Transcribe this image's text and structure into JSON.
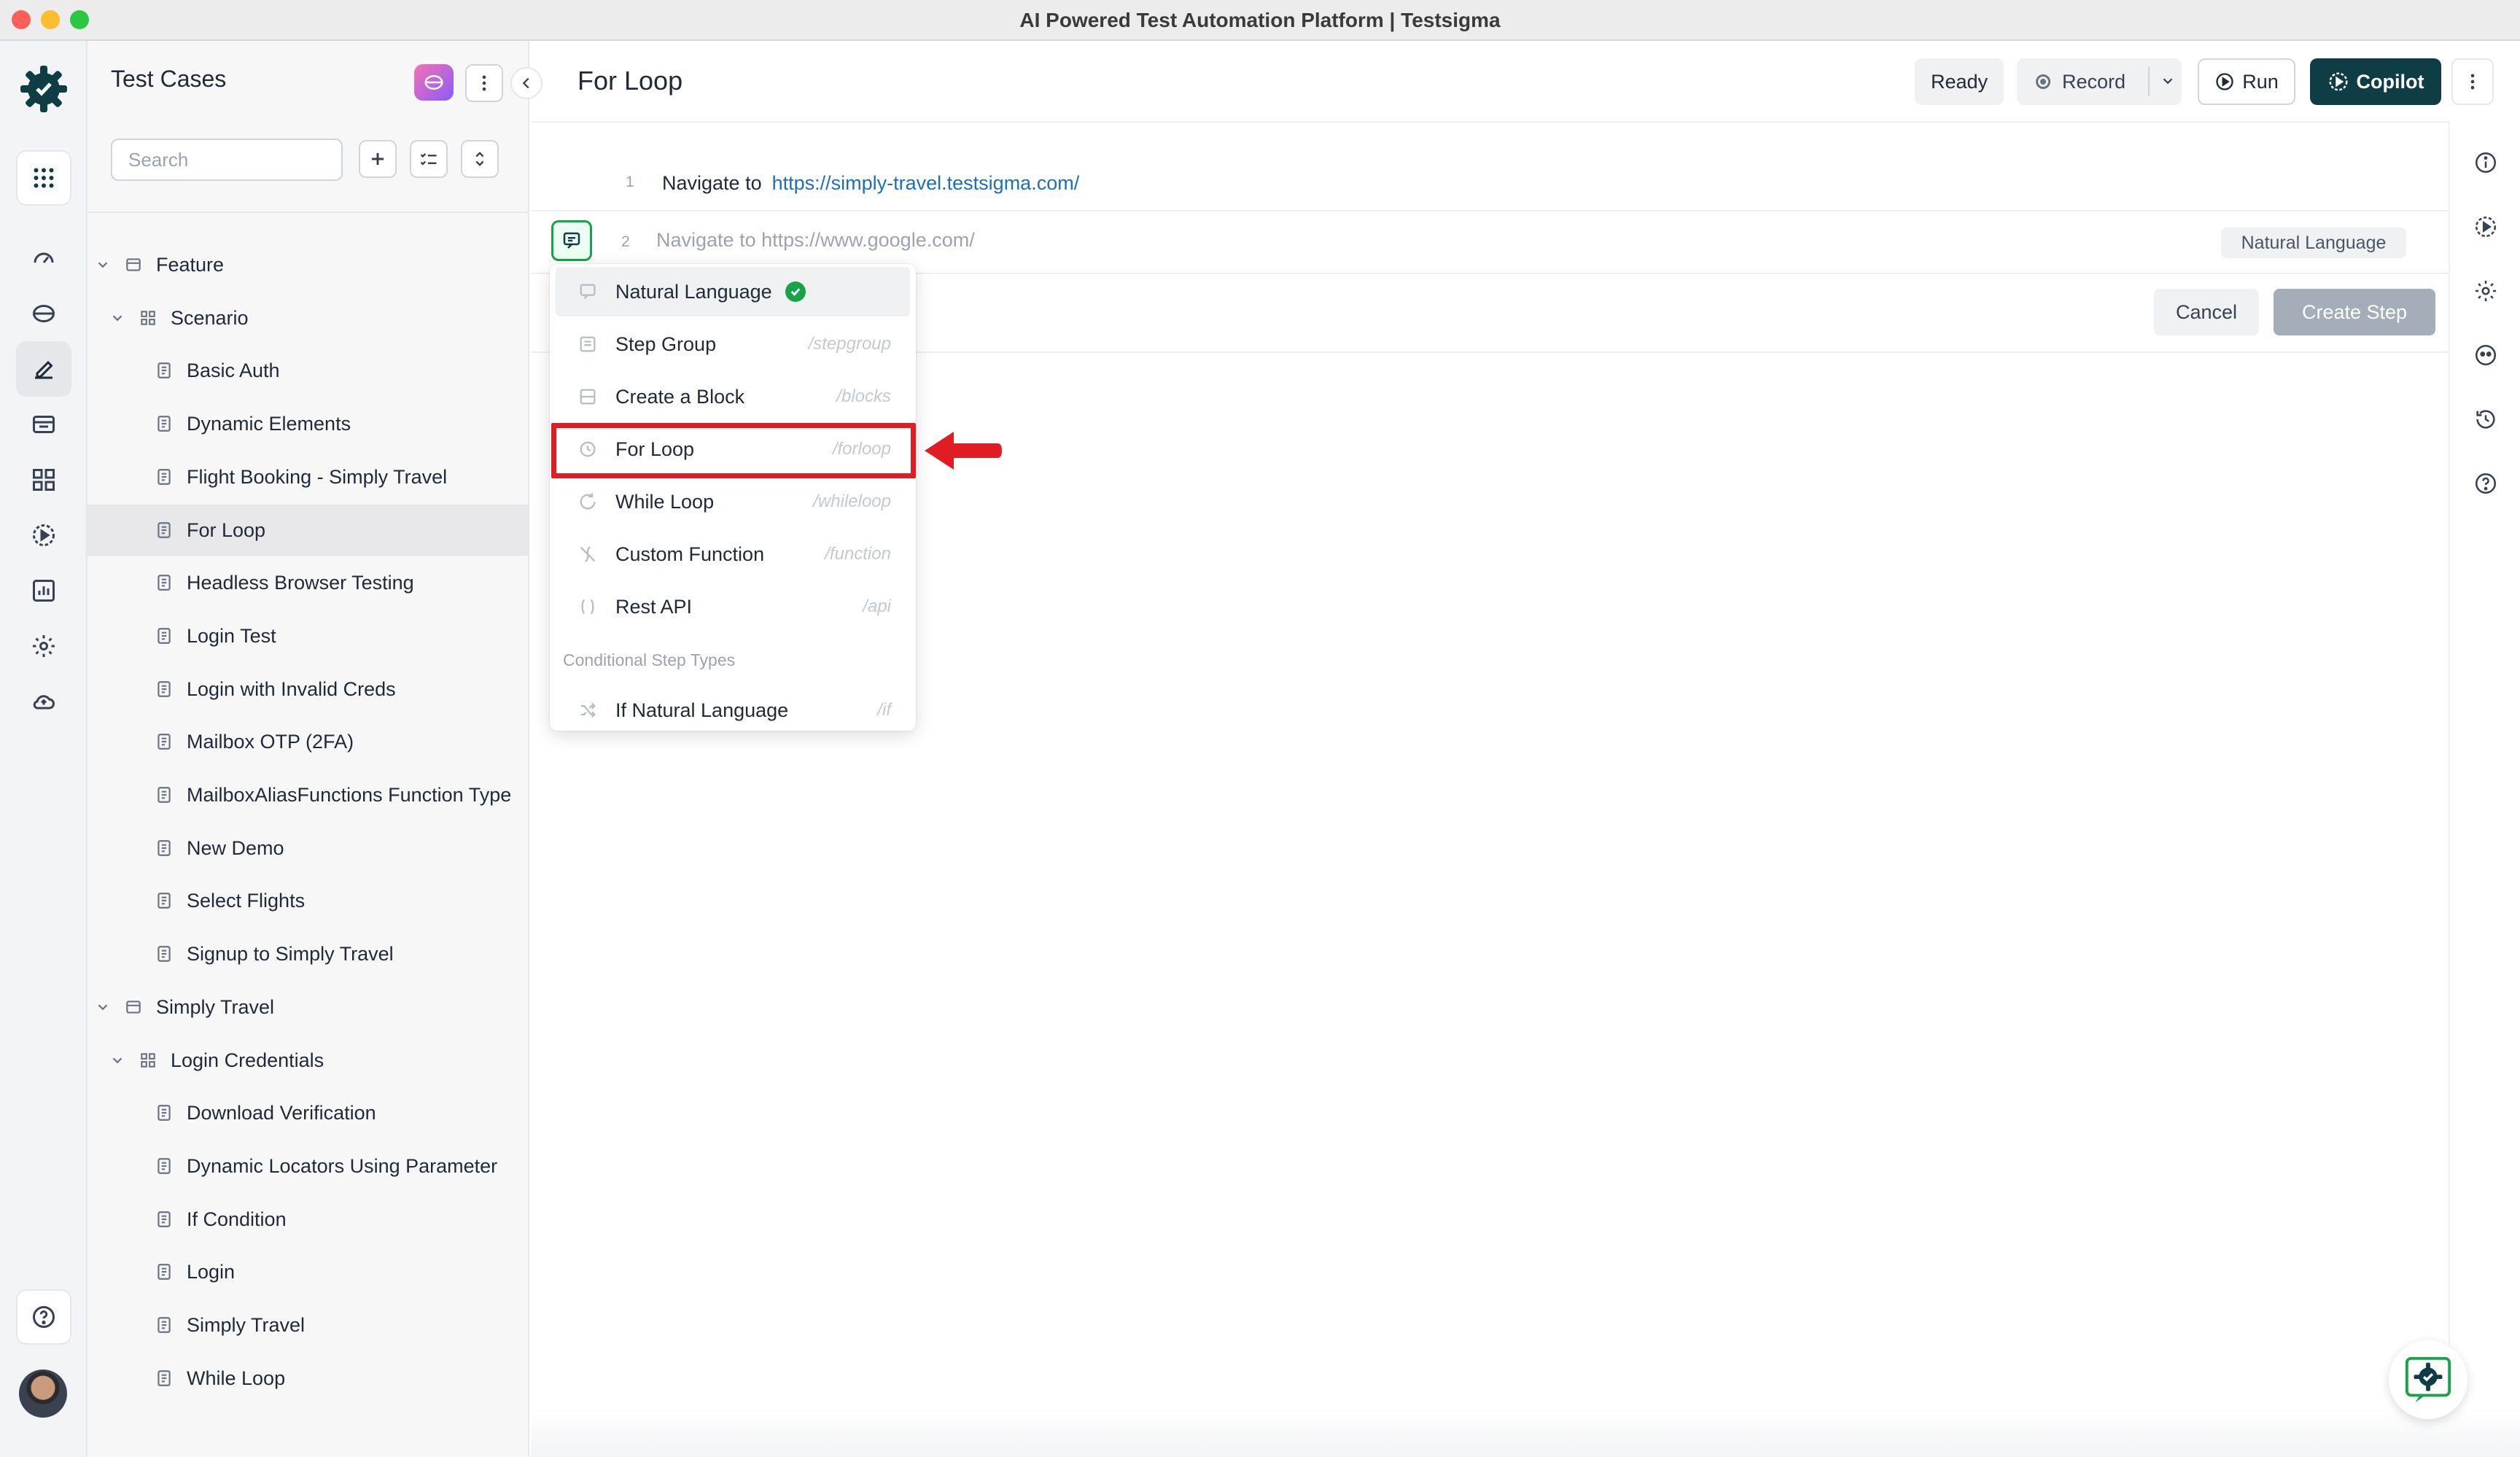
{
  "window": {
    "title": "AI Powered Test Automation Platform | Testsigma"
  },
  "rail": {
    "items": [
      "apps-grid-icon",
      "dashboard-icon",
      "projects-icon",
      "test-cases-icon",
      "test-data-icon",
      "elements-icon",
      "runs-icon",
      "reports-icon",
      "settings-icon",
      "cloud-icon",
      "help-icon"
    ],
    "active": "test-cases-icon"
  },
  "sidebar": {
    "title": "Test Cases",
    "search_placeholder": "Search",
    "tree": [
      {
        "label": "Feature",
        "kind": "feature",
        "level": 0
      },
      {
        "label": "Scenario",
        "kind": "scenario",
        "level": 1
      },
      {
        "label": "Basic Auth",
        "kind": "case",
        "level": 2
      },
      {
        "label": "Dynamic Elements",
        "kind": "case",
        "level": 2
      },
      {
        "label": "Flight Booking - Simply Travel",
        "kind": "case",
        "level": 2
      },
      {
        "label": "For Loop",
        "kind": "case",
        "level": 2,
        "selected": true
      },
      {
        "label": "Headless Browser Testing",
        "kind": "case",
        "level": 2
      },
      {
        "label": "Login Test",
        "kind": "case",
        "level": 2
      },
      {
        "label": "Login with Invalid Creds",
        "kind": "case",
        "level": 2
      },
      {
        "label": "Mailbox OTP (2FA)",
        "kind": "case",
        "level": 2
      },
      {
        "label": "MailboxAliasFunctions Function Type",
        "kind": "case",
        "level": 2
      },
      {
        "label": "New Demo",
        "kind": "case",
        "level": 2
      },
      {
        "label": "Select Flights",
        "kind": "case",
        "level": 2
      },
      {
        "label": "Signup to Simply Travel",
        "kind": "case",
        "level": 2
      },
      {
        "label": "Simply Travel",
        "kind": "feature",
        "level": 0
      },
      {
        "label": "Login Credentials",
        "kind": "scenario",
        "level": 1
      },
      {
        "label": "Download Verification",
        "kind": "case",
        "level": 2
      },
      {
        "label": "Dynamic Locators Using Parameter",
        "kind": "case",
        "level": 2
      },
      {
        "label": "If Condition",
        "kind": "case",
        "level": 2
      },
      {
        "label": "Login",
        "kind": "case",
        "level": 2
      },
      {
        "label": "Simply Travel",
        "kind": "case",
        "level": 2
      },
      {
        "label": "While Loop",
        "kind": "case",
        "level": 2
      }
    ]
  },
  "header": {
    "title": "For Loop",
    "status": "Ready",
    "record_label": "Record",
    "run_label": "Run",
    "copilot_label": "Copilot"
  },
  "steps": {
    "step1": {
      "number": "1",
      "action": "Navigate to",
      "url": "https://simply-travel.testsigma.com/"
    },
    "step2": {
      "number": "2",
      "value": "Navigate to https://www.google.com/",
      "type_chip": "Natural Language"
    }
  },
  "actions": {
    "cancel": "Cancel",
    "create": "Create Step"
  },
  "menu": {
    "items": [
      {
        "label": "Natural Language",
        "shortcut": "",
        "selected": true
      },
      {
        "label": "Step Group",
        "shortcut": "/stepgroup"
      },
      {
        "label": "Create a Block",
        "shortcut": "/blocks"
      },
      {
        "label": "For Loop",
        "shortcut": "/forloop",
        "highlighted": true
      },
      {
        "label": "While Loop",
        "shortcut": "/whileloop"
      },
      {
        "label": "Custom Function",
        "shortcut": "/function"
      },
      {
        "label": "Rest API",
        "shortcut": "/api"
      }
    ],
    "section_label": "Conditional Step Types",
    "conditional_items": [
      {
        "label": "If Natural Language",
        "shortcut": "/if"
      }
    ]
  },
  "colors": {
    "brand": "#0f3d45",
    "success": "#16a34a",
    "annotation": "#e11d24",
    "link": "#1d6fb8"
  }
}
